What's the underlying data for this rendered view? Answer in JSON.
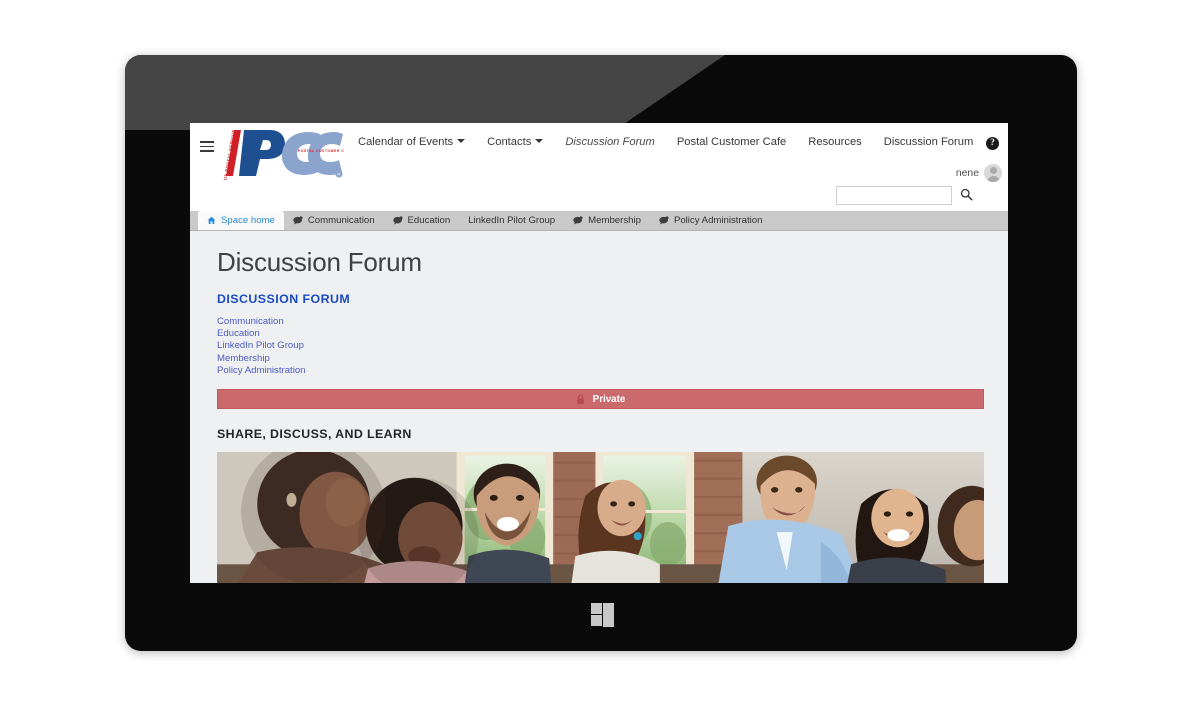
{
  "device": {
    "platform_logo": "windows-logo",
    "camera": "front-camera-dot"
  },
  "topnav": {
    "menu_icon": "hamburger-icon",
    "logo": {
      "name": "pcc-logo",
      "letters": "PCC",
      "tagline": "POSTAL CUSTOMER COUNCIL",
      "vertical_text": "US POSTAL SERVICE",
      "registered_mark": "®"
    },
    "items": [
      {
        "label": "Calendar of Events",
        "has_caret": true,
        "italic": false
      },
      {
        "label": "Contacts",
        "has_caret": true,
        "italic": false
      },
      {
        "label": "Discussion Forum",
        "has_caret": false,
        "italic": true
      },
      {
        "label": "Postal Customer Cafe",
        "has_caret": false,
        "italic": false
      },
      {
        "label": "Resources",
        "has_caret": false,
        "italic": false
      },
      {
        "label": "Discussion Forum",
        "has_caret": false,
        "italic": false
      }
    ],
    "help_icon_label": "?",
    "user_name": "nene",
    "avatar": "user-avatar",
    "search": {
      "value": "",
      "placeholder": "",
      "icon": "search-icon"
    }
  },
  "tabs": [
    {
      "label": "Space home",
      "icon": "home-icon",
      "active": true
    },
    {
      "label": "Communication",
      "icon": "comment-icon",
      "active": false
    },
    {
      "label": "Education",
      "icon": "comment-icon",
      "active": false
    },
    {
      "label": "LinkedIn Pilot Group",
      "icon": "none",
      "active": false
    },
    {
      "label": "Membership",
      "icon": "comment-icon",
      "active": false
    },
    {
      "label": "Policy Administration",
      "icon": "comment-icon",
      "active": false
    }
  ],
  "page": {
    "title": "Discussion Forum",
    "subtitle": "DISCUSSION FORUM",
    "links": [
      "Communication",
      "Education",
      "LinkedIn Pilot Group",
      "Membership",
      "Policy Administration"
    ],
    "private_banner": {
      "label": "Private",
      "icon": "lock-icon",
      "color": "#cb6a6d"
    },
    "section_heading": "SHARE, DISCUSS, AND LEARN",
    "hero_image_alt": "group of smiling colleagues collaborating at a table in a brick-walled office"
  },
  "colors": {
    "accent_blue": "#1b4bc2",
    "link_blue": "#4a5cc4",
    "active_tab_blue": "#2a8bd8",
    "private_red": "#cb6a6d",
    "page_bg": "#eff0f1",
    "tabbar_bg": "#c9c9c9"
  }
}
